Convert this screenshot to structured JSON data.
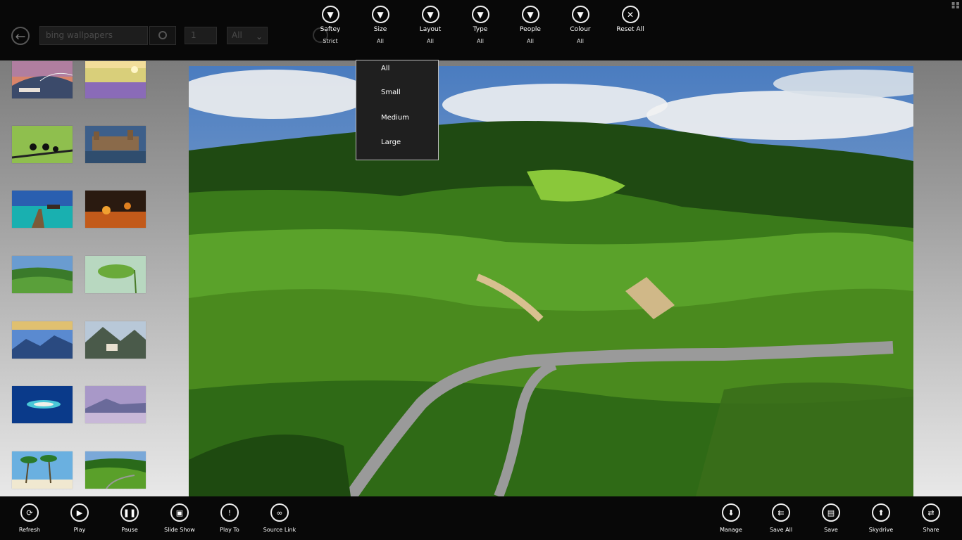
{
  "search": {
    "value": "bing wallpapers"
  },
  "page_number": "1",
  "filter_select": {
    "value": "All"
  },
  "top_buttons": [
    {
      "label": "Saftey",
      "value": "Strict",
      "icon": "filter-icon"
    },
    {
      "label": "Size",
      "value": "All",
      "icon": "filter-icon"
    },
    {
      "label": "Layout",
      "value": "All",
      "icon": "filter-icon"
    },
    {
      "label": "Type",
      "value": "All",
      "icon": "filter-icon"
    },
    {
      "label": "People",
      "value": "All",
      "icon": "filter-icon"
    },
    {
      "label": "Colour",
      "value": "All",
      "icon": "filter-icon"
    },
    {
      "label": "Reset All",
      "value": "",
      "icon": "close-icon"
    }
  ],
  "size_menu": [
    "All",
    "Small",
    "Medium",
    "Large"
  ],
  "bottom_left": [
    {
      "label": "Refresh",
      "icon": "refresh-icon"
    },
    {
      "label": "Play",
      "icon": "play-icon"
    },
    {
      "label": "Pause",
      "icon": "pause-icon"
    },
    {
      "label": "Slide Show",
      "icon": "slideshow-icon"
    },
    {
      "label": "Play To",
      "icon": "play-to-icon"
    },
    {
      "label": "Source Link",
      "icon": "link-icon"
    }
  ],
  "bottom_right": [
    {
      "label": "Manage",
      "icon": "download-icon"
    },
    {
      "label": "Save All",
      "icon": "save-all-icon"
    },
    {
      "label": "Save",
      "icon": "save-icon"
    },
    {
      "label": "Skydrive",
      "icon": "upload-icon"
    },
    {
      "label": "Share",
      "icon": "share-icon"
    }
  ],
  "thumbnails": [
    "harbor-bridge-sunset",
    "lavender-field",
    "birds-on-branch",
    "castle-reflection",
    "pier-tropical-sea",
    "hot-air-balloons-night",
    "green-hills",
    "lotus-leaf",
    "mountain-dawn",
    "mountain-town",
    "atoll-aerial",
    "misty-lake-mountain",
    "palm-beach",
    "vineyard-road"
  ],
  "main_image": "vineyard-hills-winding-road"
}
